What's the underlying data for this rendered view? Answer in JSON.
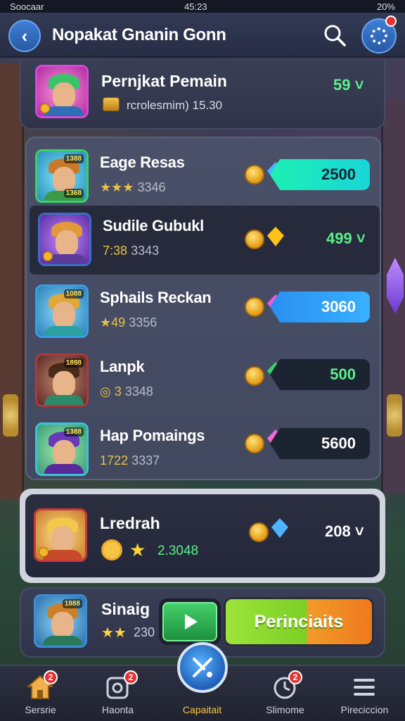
{
  "status_bar": {
    "carrier": "Soocaar",
    "time": "45:23",
    "battery": "20%"
  },
  "header": {
    "title": "Nopakat Gnanin Gonn",
    "colors": {
      "accent": "#3f7fd6",
      "header_bg": "#2c334c"
    }
  },
  "top_player": {
    "name": "Pernjkat Pemain",
    "sub": "rcrolesmim) 15.30",
    "score": "59 ˅"
  },
  "players": [
    {
      "name": "Eage Resas",
      "rating": "★★★",
      "sub": "3346",
      "avatar_level": "1388",
      "avatar_level2": "1368",
      "value": "2500",
      "gem_color": "#4fb2ff",
      "bar": "#19e0c8"
    },
    {
      "name": "Sudile Gubukl",
      "rating": "7:38",
      "sub": "3343",
      "value": "499 ˅",
      "gem_color": "#ffc21a",
      "bar": ""
    },
    {
      "name": "Sphails Reckan",
      "rating": "★49",
      "sub": "3356",
      "avatar_level": "1088",
      "value": "3060",
      "gem_color": "#ef5bd9",
      "bar": "#2a9bf0"
    },
    {
      "name": "Lanpk",
      "rating": "3",
      "sub": "3348",
      "avatar_level": "1898",
      "value": "500",
      "gem_color": "#35d66a",
      "bar": "#1e2431"
    },
    {
      "name": "Hap Pomaings",
      "rating": "1722",
      "sub": "3337",
      "avatar_level": "1388",
      "value": "5600",
      "gem_color": "#f06ad6",
      "bar": "#1e2431"
    }
  ],
  "selected_player": {
    "name": "Lredrah",
    "sub": "2.3048",
    "value": "208 ˅"
  },
  "bottom_player": {
    "name": "Sinaig",
    "stars": "★★",
    "sub": "230",
    "avatar_level": "1988",
    "cta_label": "Perinciaits"
  },
  "nav": [
    {
      "label": "Sersrie",
      "badge": "2"
    },
    {
      "label": "Haonta",
      "badge": "2"
    },
    {
      "label": "Capaitait"
    },
    {
      "label": "Slimome",
      "badge": "2"
    },
    {
      "label": "Pireciccion"
    }
  ]
}
